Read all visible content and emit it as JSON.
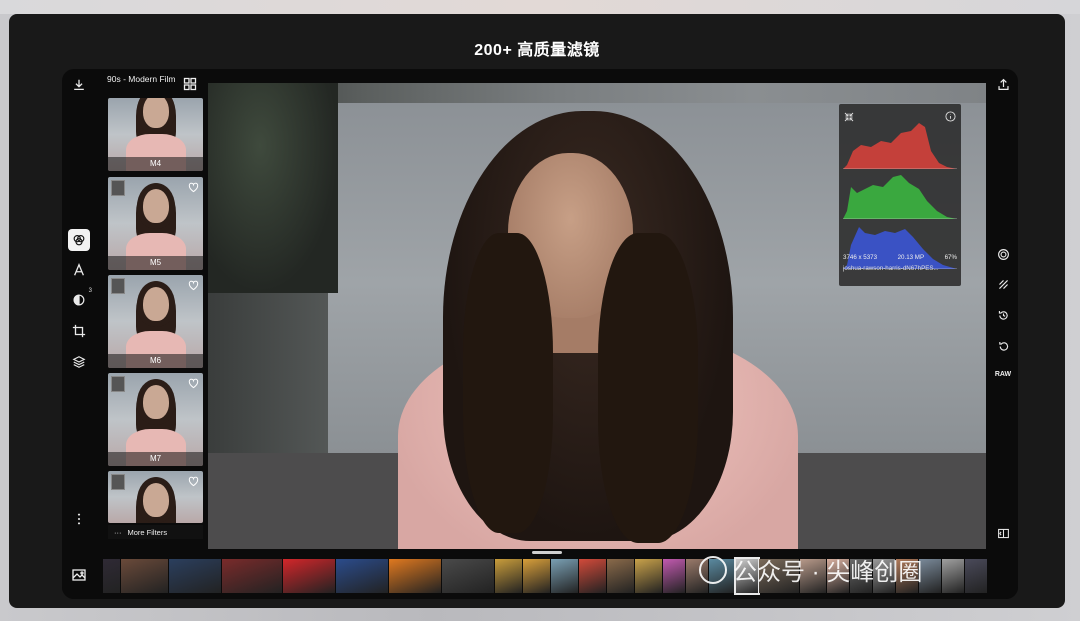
{
  "headline": "200+ 高质量滤镜",
  "filter_panel": {
    "title": "90s - Modern Film",
    "items": [
      {
        "label": "M4"
      },
      {
        "label": "M5"
      },
      {
        "label": "M6"
      },
      {
        "label": "M7"
      },
      {
        "label": ""
      }
    ],
    "more_label": "More Filters"
  },
  "left_tools": {
    "adjust_badge": "3"
  },
  "histogram": {
    "dimensions": "3746 x 5373",
    "megapixels": "20.13 MP",
    "zoom": "67%",
    "filename": "joshua-rawson-harris-dN67hPES...",
    "colors": {
      "red": "#c4403a",
      "green": "#3aa83f",
      "blue": "#3a52c4"
    }
  },
  "right_tools": {
    "raw_label": "RAW"
  },
  "filmstrip": {
    "colors": [
      "#2f2a35",
      "#6a4a3a",
      "#2b3f5e",
      "#7a2b2b",
      "#d3262a",
      "#2b4c8c",
      "#e0791f",
      "#4a4a4a",
      "#c99d3b",
      "#d89f3a",
      "#7aa0b4",
      "#d24a3a",
      "#8a6a4a",
      "#c9a24a",
      "#c25ab0",
      "#9a7a6a",
      "#5a8aa0",
      "#cfcfcf",
      "#7a6a5a",
      "#b89a8a",
      "#d8b0a0",
      "#6a6a6a",
      "#9a9a9a",
      "#b07a5a",
      "#7a8a9a",
      "#a0a0a0",
      "#4a4a5a"
    ]
  },
  "watermark": "公众号 · 尖峰创圈"
}
